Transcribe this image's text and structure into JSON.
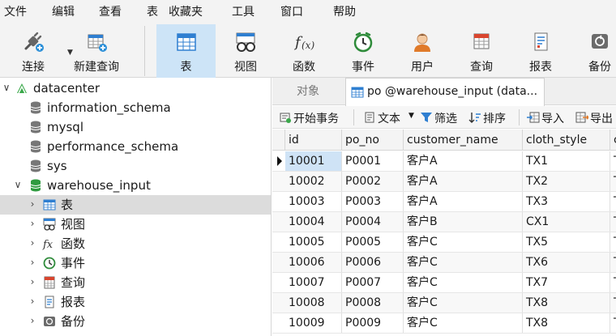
{
  "menu": [
    "文件",
    "编辑",
    "查看",
    "表",
    "收藏夹",
    "工具",
    "窗口",
    "帮助"
  ],
  "toolbar": {
    "connect": "连接",
    "new_query": "新建查询",
    "table": "表",
    "view": "视图",
    "function": "函数",
    "event": "事件",
    "user": "用户",
    "query": "查询",
    "report": "报表",
    "backup": "备份"
  },
  "tree": {
    "connection": "datacenter",
    "databases": [
      "information_schema",
      "mysql",
      "performance_schema",
      "sys"
    ],
    "open_database": "warehouse_input",
    "children": [
      "表",
      "视图",
      "函数",
      "事件",
      "查询",
      "报表",
      "备份"
    ]
  },
  "tabs": {
    "objects": "对象",
    "active": "po @warehouse_input (data..."
  },
  "subtoolbar": {
    "begin_transaction": "开始事务",
    "text": "文本",
    "filter": "筛选",
    "sort": "排序",
    "import": "导入",
    "export": "导出"
  },
  "grid": {
    "columns": [
      "id",
      "po_no",
      "customer_name",
      "cloth_style",
      "c"
    ],
    "rows": [
      [
        "10001",
        "P0001",
        "客户A",
        "TX1",
        "T"
      ],
      [
        "10002",
        "P0002",
        "客户A",
        "TX2",
        "T"
      ],
      [
        "10003",
        "P0003",
        "客户A",
        "TX3",
        "T"
      ],
      [
        "10004",
        "P0004",
        "客户B",
        "CX1",
        "T"
      ],
      [
        "10005",
        "P0005",
        "客户C",
        "TX5",
        "T"
      ],
      [
        "10006",
        "P0006",
        "客户C",
        "TX6",
        "T"
      ],
      [
        "10007",
        "P0007",
        "客户C",
        "TX7",
        "T"
      ],
      [
        "10008",
        "P0008",
        "客户C",
        "TX8",
        "T"
      ],
      [
        "10009",
        "P0009",
        "客户C",
        "TX8",
        "T"
      ]
    ]
  }
}
